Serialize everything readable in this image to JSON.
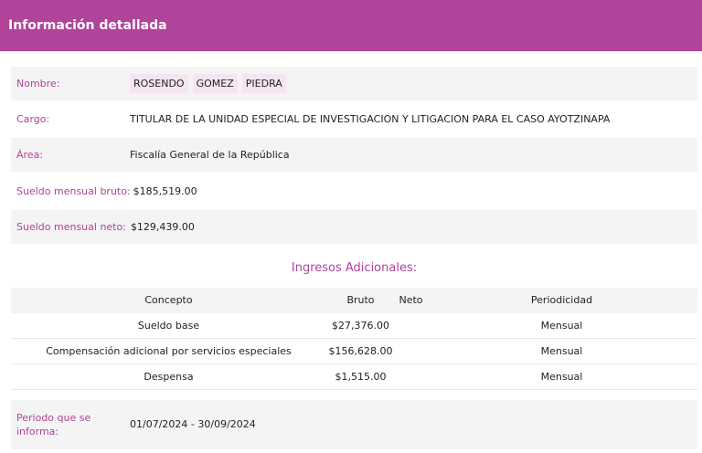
{
  "header": {
    "title": "Información detallada"
  },
  "profile": {
    "name_label": "Nombre:",
    "name_parts": [
      "ROSENDO",
      "GOMEZ",
      "PIEDRA"
    ],
    "cargo_label": "Cargo:",
    "cargo_value": "TITULAR DE LA UNIDAD ESPECIAL DE INVESTIGACION Y LITIGACION PARA EL CASO AYOTZINAPA",
    "area_label": "Área:",
    "area_value": "Fiscalía General de la República",
    "bruto_label": "Sueldo mensual bruto:",
    "bruto_value": "$185,519.00",
    "neto_label": "Sueldo mensual neto:",
    "neto_value": "$129,439.00"
  },
  "ingresos": {
    "title": "Ingresos Adicionales:",
    "headers": {
      "concepto": "Concepto",
      "bruto": "Bruto",
      "neto": "Neto",
      "periodicidad": "Periodicidad"
    },
    "rows": [
      {
        "concepto": "Sueldo base",
        "bruto": "$27,376.00",
        "neto": "",
        "periodicidad": "Mensual"
      },
      {
        "concepto": "Compensación adicional por servicios especiales",
        "bruto": "$156,628.00",
        "neto": "",
        "periodicidad": "Mensual"
      },
      {
        "concepto": "Despensa",
        "bruto": "$1,515.00",
        "neto": "",
        "periodicidad": "Mensual"
      }
    ]
  },
  "periodo": {
    "label": "Periodo que se informa:",
    "value": "01/07/2024 - 30/09/2024"
  }
}
